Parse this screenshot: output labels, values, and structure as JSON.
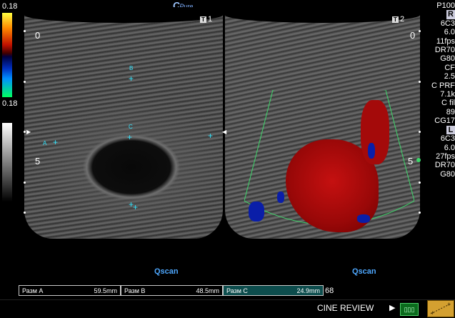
{
  "colorbar": {
    "top_value": "0.18",
    "bottom_value": "0.18"
  },
  "logo": {
    "brand": "Pure",
    "mark": "C"
  },
  "views": [
    {
      "id": "T1",
      "badge": "1",
      "depth_top": "0",
      "depth_mid": "5",
      "label": "Qscan"
    },
    {
      "id": "T2",
      "badge": "2",
      "depth_top": "0",
      "depth_mid": "5",
      "label": "Qscan"
    }
  ],
  "calipers": {
    "A": "A",
    "B": "B",
    "C": "C"
  },
  "measurements": [
    {
      "name": "Разм A",
      "value": "59.5mm"
    },
    {
      "name": "Разм B",
      "value": "48.5mm"
    },
    {
      "name": "Разм C",
      "value": "24.9mm"
    }
  ],
  "frame_count": "68",
  "cine": {
    "label": "CINE REVIEW",
    "arrow": "▶"
  },
  "params": [
    "P100",
    "R",
    "6C3",
    "6.0",
    "11fps",
    "DR70",
    "G80",
    "CF",
    "2.5",
    "C PRF",
    "7.1k",
    "C fil",
    "89",
    "CG17",
    "L",
    "6C3",
    "6.0",
    "27fps",
    "DR70",
    "G80"
  ],
  "colors": {
    "caliper": "#33e6ff",
    "qscan": "#4ea8ff",
    "roi": "#3dd66a",
    "doppler_red": "#b00808",
    "doppler_blue": "#0a1ea8"
  }
}
